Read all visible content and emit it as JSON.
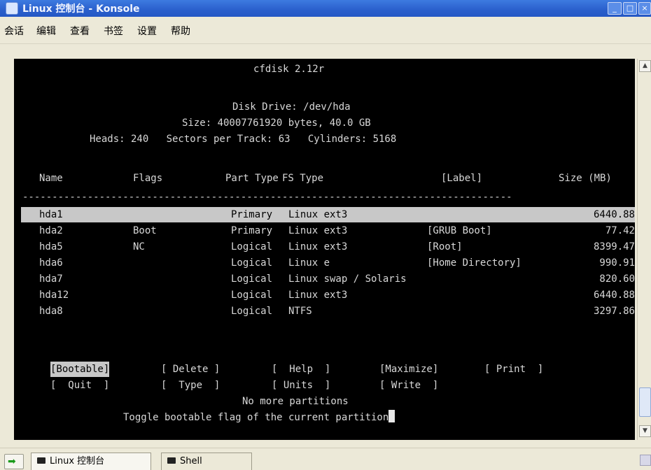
{
  "window": {
    "title": "Linux 控制台 - Konsole"
  },
  "menu": {
    "items": [
      "会话",
      "编辑",
      "查看",
      "书签",
      "设置",
      "帮助"
    ]
  },
  "terminal": {
    "app_title": "cfdisk 2.12r",
    "disk_drive": "Disk Drive: /dev/hda",
    "size_line": "Size: 40007761920 bytes, 40.0 GB",
    "geometry_line": "Heads: 240   Sectors per Track: 63   Cylinders: 5168",
    "headers": {
      "name": "Name",
      "flags": "Flags",
      "part_type": "Part Type",
      "fs_type": "FS Type",
      "label": "[Label]",
      "size": "Size (MB)"
    },
    "separator": "-----------------------------------------------------------------------------------",
    "partitions": [
      {
        "name": "hda1",
        "flags": "",
        "part_type": "Primary",
        "fs_type": "Linux ext3",
        "label": "",
        "size": "6440.88",
        "selected": true
      },
      {
        "name": "hda2",
        "flags": "Boot",
        "part_type": "Primary",
        "fs_type": "Linux ext3",
        "label": "[GRUB Boot]",
        "size": "77.42",
        "selected": false
      },
      {
        "name": "hda5",
        "flags": "NC",
        "part_type": "Logical",
        "fs_type": "Linux ext3",
        "label": "[Root]",
        "size": "8399.47",
        "selected": false
      },
      {
        "name": "hda6",
        "flags": "",
        "part_type": "Logical",
        "fs_type": "Linux e",
        "label": "[Home Directory]",
        "size": "990.91",
        "selected": false
      },
      {
        "name": "hda7",
        "flags": "",
        "part_type": "Logical",
        "fs_type": "Linux swap / Solaris",
        "label": "",
        "size": "820.60",
        "selected": false
      },
      {
        "name": "hda12",
        "flags": "",
        "part_type": "Logical",
        "fs_type": "Linux ext3",
        "label": "",
        "size": "6440.88",
        "selected": false
      },
      {
        "name": "hda8",
        "flags": "",
        "part_type": "Logical",
        "fs_type": "NTFS",
        "label": "",
        "size": "3297.86",
        "selected": false
      }
    ],
    "buttons_row1": [
      "[Bootable]",
      "[ Delete ]",
      "[  Help  ]",
      "[Maximize]",
      "[ Print  ]"
    ],
    "buttons_row2": [
      "[  Quit  ]",
      "[  Type  ]",
      "[ Units  ]",
      "[ Write  ]"
    ],
    "status": "No more partitions",
    "help_text": "Toggle bootable flag of the current partition"
  },
  "tabs": [
    {
      "label": "Linux 控制台",
      "active": true
    },
    {
      "label": "Shell",
      "active": false
    }
  ],
  "colors": {
    "terminal_bg": "#000000",
    "terminal_fg": "#d8d8d8",
    "highlight_bg": "#c8c8c8",
    "titlebar": "#2a5fcc",
    "chrome": "#ece9d8"
  }
}
